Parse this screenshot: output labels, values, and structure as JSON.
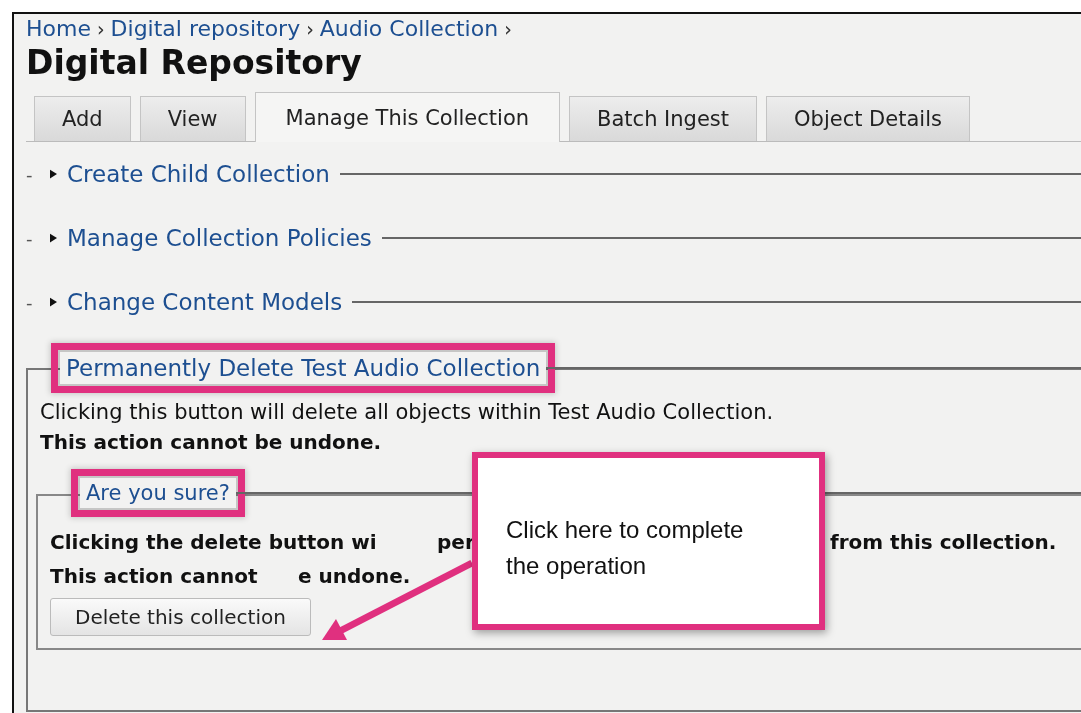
{
  "breadcrumb": [
    {
      "label": "Home",
      "separator": "›"
    },
    {
      "label": "Digital repository",
      "separator": "›"
    },
    {
      "label": "Audio Collection",
      "separator": "›"
    }
  ],
  "title": "Digital Repository",
  "tabs": [
    {
      "label": "Add",
      "selected": false
    },
    {
      "label": "View",
      "selected": false
    },
    {
      "label": "Manage This Collection",
      "selected": true
    },
    {
      "label": "Batch Ingest",
      "selected": false
    },
    {
      "label": "Object Details",
      "selected": false
    }
  ],
  "sections": [
    {
      "toggle": "-",
      "title": "Create Child Collection",
      "expanded": false
    },
    {
      "toggle": "-",
      "title": "Manage Collection Policies",
      "expanded": false
    },
    {
      "toggle": "-",
      "title": "Change Content Models",
      "expanded": false
    }
  ],
  "delete_section": {
    "legend": "Permanently Delete Test Audio Collection",
    "highlighted": true,
    "text": "Clicking this button will delete all objects within Test Audio Collection.",
    "warning": "This action cannot be undone.",
    "confirm": {
      "legend": "Are you sure?",
      "highlighted": true,
      "line_1": [
        "Clicking the delete button wi",
        "per",
        "from this collection."
      ],
      "line_2": [
        "This action cannot",
        "e undone."
      ],
      "button": "Delete this collection"
    }
  },
  "annotation": {
    "text": "Click here to complete the operation"
  }
}
